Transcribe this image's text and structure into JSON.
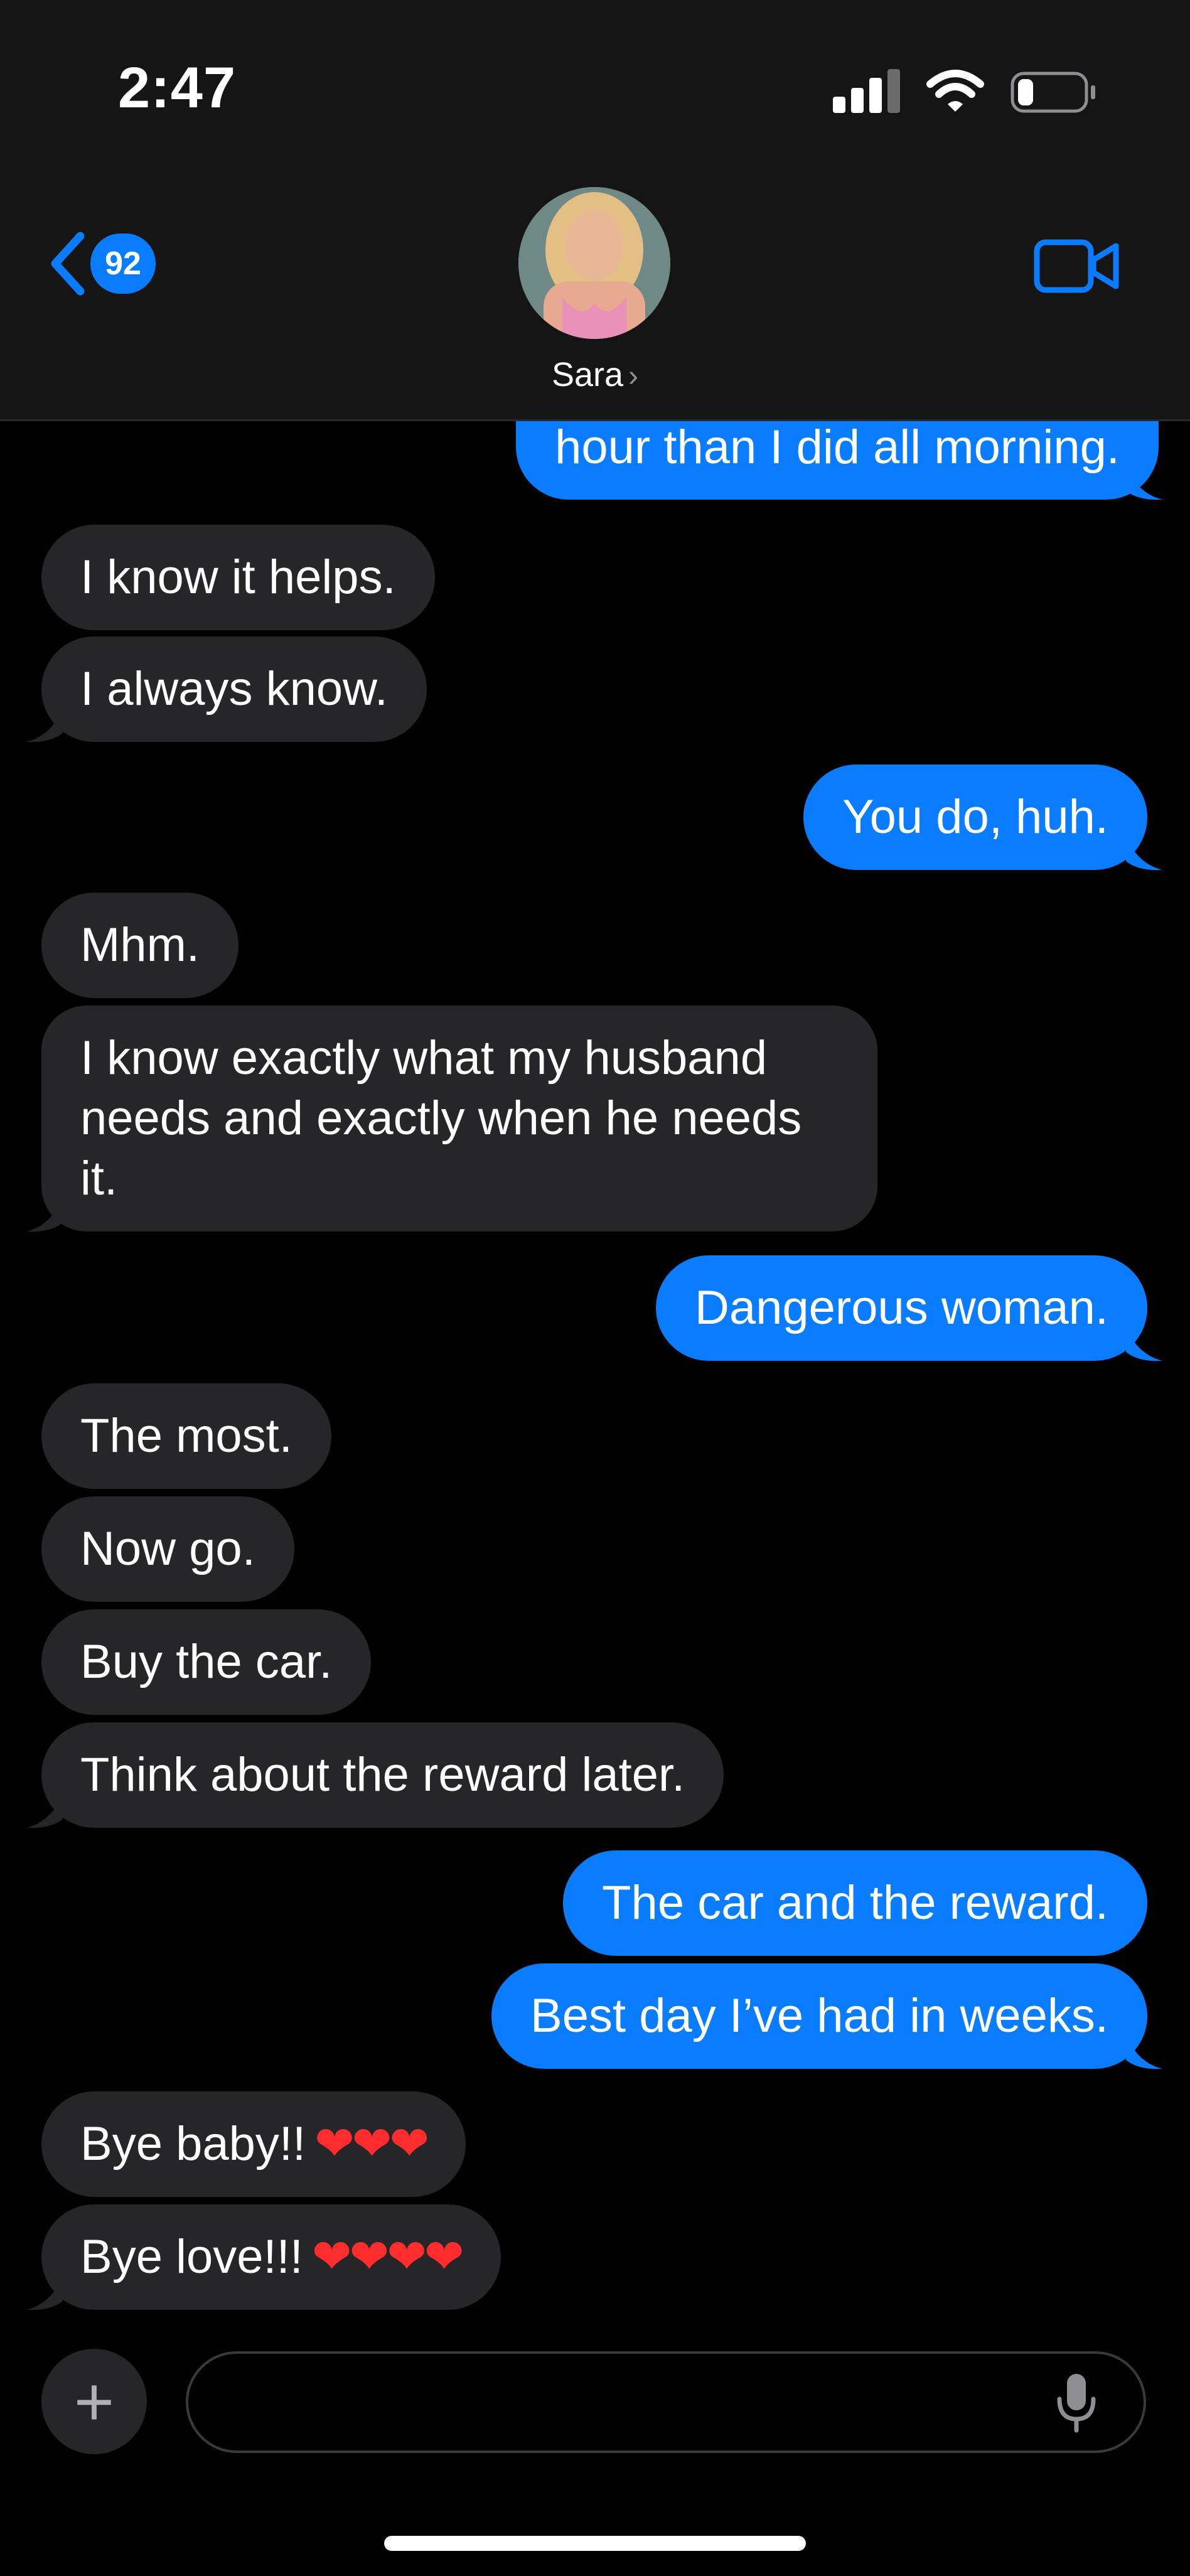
{
  "status_bar": {
    "time": "2:47"
  },
  "header": {
    "back_badge": "92",
    "contact_name": "Sara",
    "contact_chevron": "›"
  },
  "messages": [
    {
      "dir": "out",
      "text": "hour than I did all morning."
    },
    {
      "dir": "in",
      "text": "I know it helps."
    },
    {
      "dir": "in",
      "text": "I always know."
    },
    {
      "dir": "out",
      "text": "You do, huh."
    },
    {
      "dir": "in",
      "text": "Mhm."
    },
    {
      "dir": "in",
      "text": "I know exactly what my husband needs and exactly when he needs it."
    },
    {
      "dir": "out",
      "text": "Dangerous woman."
    },
    {
      "dir": "in",
      "text": "The most."
    },
    {
      "dir": "in",
      "text": "Now go."
    },
    {
      "dir": "in",
      "text": "Buy the car."
    },
    {
      "dir": "in",
      "text": "Think about the reward later."
    },
    {
      "dir": "out",
      "text": "The car and the reward."
    },
    {
      "dir": "out",
      "text": "Best day I’ve had in weeks."
    },
    {
      "dir": "in",
      "text": "Bye baby!!",
      "hearts": "❤❤❤"
    },
    {
      "dir": "in",
      "text": "Bye love!!!",
      "hearts": "❤❤❤❤"
    }
  ],
  "composer": {
    "plus_label": "+",
    "placeholder": ""
  },
  "icons": {
    "back": "chevron-left-icon",
    "video": "video-camera-icon",
    "mic": "microphone-icon",
    "wifi": "wifi-icon",
    "battery": "battery-icon",
    "signal": "cellular-signal-icon"
  },
  "colors": {
    "outgoing_bubble": "#0a7cff",
    "incoming_bubble": "#262628",
    "background": "#000000",
    "header": "#151515",
    "hearts": "#ff2d2d"
  }
}
